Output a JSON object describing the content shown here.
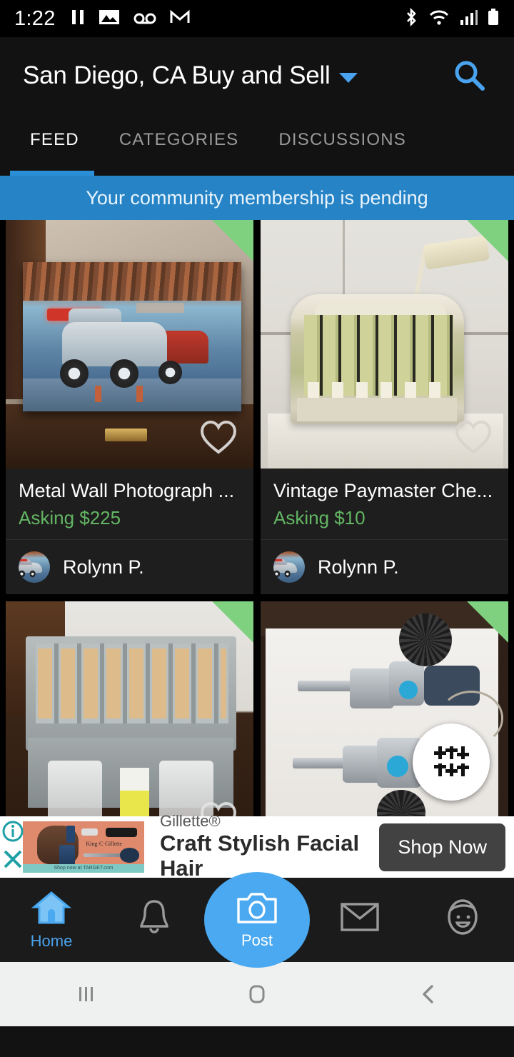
{
  "status_bar": {
    "time": "1:22",
    "left_icons": [
      "pause-icon",
      "photo-icon",
      "voicemail-icon",
      "gmail-icon"
    ],
    "right_icons": [
      "bluetooth-icon",
      "wifi-icon",
      "cellular-signal-icon",
      "battery-icon"
    ]
  },
  "header": {
    "title": "San Diego, CA Buy and Sell",
    "dropdown_icon": "chevron-down-icon",
    "search_icon": "search-icon",
    "accent_color": "#4aa3ef"
  },
  "tabs": [
    {
      "label": "FEED",
      "active": true
    },
    {
      "label": "CATEGORIES",
      "active": false
    },
    {
      "label": "DISCUSSIONS",
      "active": false
    }
  ],
  "banner": {
    "text": "Your community membership is pending",
    "background_color": "#2684c6"
  },
  "feed": {
    "price_color": "#63b563",
    "ribbon_color": "#7fd17f",
    "favorite_icon": "heart-icon",
    "cards": [
      {
        "title": "Metal Wall Photograph ...",
        "price": "Asking $225",
        "seller": "Rolynn P.",
        "image": "vintage-hot-rod-metal-wall-art-photo"
      },
      {
        "title": "Vintage Paymaster Che...",
        "price": "Asking $10",
        "seller": "Rolynn P.",
        "image": "vintage-paymaster-check-writer-photo"
      },
      {
        "title": "",
        "price": "",
        "seller": "",
        "image": "box-of-hardware-parts-photo"
      },
      {
        "title": "",
        "price": "",
        "seller": "",
        "image": "scuba-tank-valves-photo"
      }
    ],
    "filter_fab_icon": "filter-sliders-icon"
  },
  "ad": {
    "sponsor": "Gillette®",
    "headline": "Craft Stylish Facial Hair",
    "cta_label": "Shop Now",
    "info_icon": "info-icon",
    "close_icon": "close-icon",
    "creative_brand": "King·C·Gillette",
    "creative_footer": "Shop now at TARGET.com",
    "cta_color": "#424242"
  },
  "bottom_nav": {
    "items": [
      {
        "label": "Home",
        "icon": "home-icon",
        "active": true
      },
      {
        "label": "",
        "icon": "bell-icon",
        "active": false
      },
      {
        "label": "Post",
        "icon": "camera-icon",
        "active": false
      },
      {
        "label": "",
        "icon": "envelope-icon",
        "active": false
      },
      {
        "label": "",
        "icon": "profile-face-icon",
        "active": false
      }
    ],
    "accent_color": "#4aa9f0"
  },
  "android_nav": {
    "recents_icon": "recents-icon",
    "home_icon": "home-square-icon",
    "back_icon": "back-chevron-icon"
  }
}
